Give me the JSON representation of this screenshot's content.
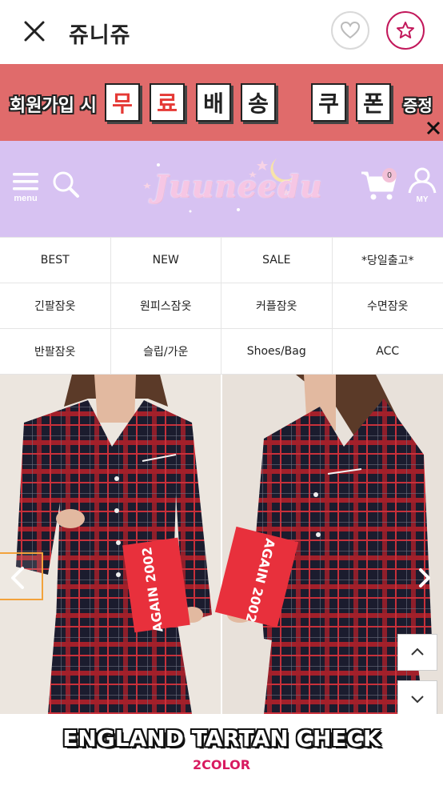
{
  "appbar": {
    "title": "쥬니쥬",
    "close_icon": "close-icon",
    "heart_icon": "heart-icon",
    "star_icon": "star-icon"
  },
  "promo": {
    "lead": "회원가입 시",
    "tiles_red": [
      "무",
      "료"
    ],
    "tiles_dark": [
      "배",
      "송"
    ],
    "tiles_coupon": [
      "쿠",
      "폰"
    ],
    "tail": "증정",
    "bg_color": "#e06b6b"
  },
  "header": {
    "menu_label": "menu",
    "logo_text": "Juuneedu",
    "cart_count": "0",
    "my_label": "MY",
    "bg_color": "#d7c2f2"
  },
  "categories": [
    [
      "BEST",
      "NEW",
      "SALE",
      "*당일출고*"
    ],
    [
      "긴팔잠옷",
      "원피스잠옷",
      "커플잠옷",
      "수면잠옷"
    ],
    [
      "반팔잠옷",
      "슬립/가운",
      "Shoes/Bag",
      "ACC"
    ]
  ],
  "product": {
    "book_text": "AGAIN 2002",
    "title": "ENGLAND TARTAN CHECK",
    "subtitle": "2COLOR"
  }
}
